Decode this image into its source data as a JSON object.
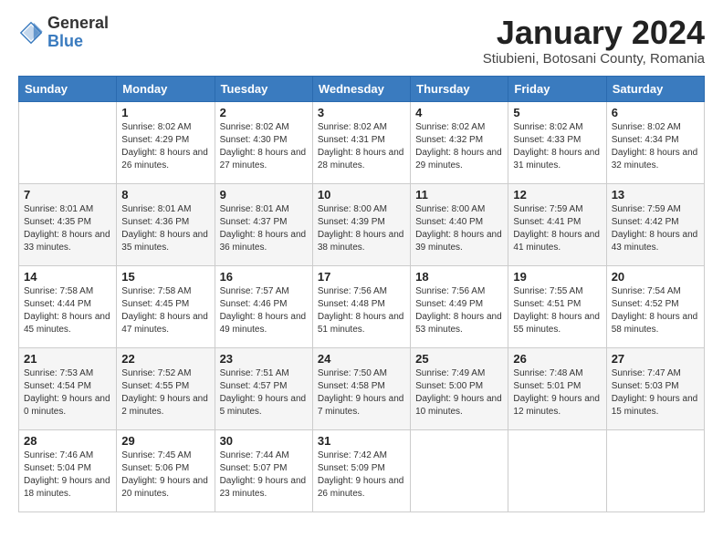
{
  "logo": {
    "general": "General",
    "blue": "Blue"
  },
  "title": "January 2024",
  "subtitle": "Stiubieni, Botosani County, Romania",
  "days_of_week": [
    "Sunday",
    "Monday",
    "Tuesday",
    "Wednesday",
    "Thursday",
    "Friday",
    "Saturday"
  ],
  "weeks": [
    [
      {
        "num": "",
        "sunrise": "",
        "sunset": "",
        "daylight": ""
      },
      {
        "num": "1",
        "sunrise": "Sunrise: 8:02 AM",
        "sunset": "Sunset: 4:29 PM",
        "daylight": "Daylight: 8 hours and 26 minutes."
      },
      {
        "num": "2",
        "sunrise": "Sunrise: 8:02 AM",
        "sunset": "Sunset: 4:30 PM",
        "daylight": "Daylight: 8 hours and 27 minutes."
      },
      {
        "num": "3",
        "sunrise": "Sunrise: 8:02 AM",
        "sunset": "Sunset: 4:31 PM",
        "daylight": "Daylight: 8 hours and 28 minutes."
      },
      {
        "num": "4",
        "sunrise": "Sunrise: 8:02 AM",
        "sunset": "Sunset: 4:32 PM",
        "daylight": "Daylight: 8 hours and 29 minutes."
      },
      {
        "num": "5",
        "sunrise": "Sunrise: 8:02 AM",
        "sunset": "Sunset: 4:33 PM",
        "daylight": "Daylight: 8 hours and 31 minutes."
      },
      {
        "num": "6",
        "sunrise": "Sunrise: 8:02 AM",
        "sunset": "Sunset: 4:34 PM",
        "daylight": "Daylight: 8 hours and 32 minutes."
      }
    ],
    [
      {
        "num": "7",
        "sunrise": "Sunrise: 8:01 AM",
        "sunset": "Sunset: 4:35 PM",
        "daylight": "Daylight: 8 hours and 33 minutes."
      },
      {
        "num": "8",
        "sunrise": "Sunrise: 8:01 AM",
        "sunset": "Sunset: 4:36 PM",
        "daylight": "Daylight: 8 hours and 35 minutes."
      },
      {
        "num": "9",
        "sunrise": "Sunrise: 8:01 AM",
        "sunset": "Sunset: 4:37 PM",
        "daylight": "Daylight: 8 hours and 36 minutes."
      },
      {
        "num": "10",
        "sunrise": "Sunrise: 8:00 AM",
        "sunset": "Sunset: 4:39 PM",
        "daylight": "Daylight: 8 hours and 38 minutes."
      },
      {
        "num": "11",
        "sunrise": "Sunrise: 8:00 AM",
        "sunset": "Sunset: 4:40 PM",
        "daylight": "Daylight: 8 hours and 39 minutes."
      },
      {
        "num": "12",
        "sunrise": "Sunrise: 7:59 AM",
        "sunset": "Sunset: 4:41 PM",
        "daylight": "Daylight: 8 hours and 41 minutes."
      },
      {
        "num": "13",
        "sunrise": "Sunrise: 7:59 AM",
        "sunset": "Sunset: 4:42 PM",
        "daylight": "Daylight: 8 hours and 43 minutes."
      }
    ],
    [
      {
        "num": "14",
        "sunrise": "Sunrise: 7:58 AM",
        "sunset": "Sunset: 4:44 PM",
        "daylight": "Daylight: 8 hours and 45 minutes."
      },
      {
        "num": "15",
        "sunrise": "Sunrise: 7:58 AM",
        "sunset": "Sunset: 4:45 PM",
        "daylight": "Daylight: 8 hours and 47 minutes."
      },
      {
        "num": "16",
        "sunrise": "Sunrise: 7:57 AM",
        "sunset": "Sunset: 4:46 PM",
        "daylight": "Daylight: 8 hours and 49 minutes."
      },
      {
        "num": "17",
        "sunrise": "Sunrise: 7:56 AM",
        "sunset": "Sunset: 4:48 PM",
        "daylight": "Daylight: 8 hours and 51 minutes."
      },
      {
        "num": "18",
        "sunrise": "Sunrise: 7:56 AM",
        "sunset": "Sunset: 4:49 PM",
        "daylight": "Daylight: 8 hours and 53 minutes."
      },
      {
        "num": "19",
        "sunrise": "Sunrise: 7:55 AM",
        "sunset": "Sunset: 4:51 PM",
        "daylight": "Daylight: 8 hours and 55 minutes."
      },
      {
        "num": "20",
        "sunrise": "Sunrise: 7:54 AM",
        "sunset": "Sunset: 4:52 PM",
        "daylight": "Daylight: 8 hours and 58 minutes."
      }
    ],
    [
      {
        "num": "21",
        "sunrise": "Sunrise: 7:53 AM",
        "sunset": "Sunset: 4:54 PM",
        "daylight": "Daylight: 9 hours and 0 minutes."
      },
      {
        "num": "22",
        "sunrise": "Sunrise: 7:52 AM",
        "sunset": "Sunset: 4:55 PM",
        "daylight": "Daylight: 9 hours and 2 minutes."
      },
      {
        "num": "23",
        "sunrise": "Sunrise: 7:51 AM",
        "sunset": "Sunset: 4:57 PM",
        "daylight": "Daylight: 9 hours and 5 minutes."
      },
      {
        "num": "24",
        "sunrise": "Sunrise: 7:50 AM",
        "sunset": "Sunset: 4:58 PM",
        "daylight": "Daylight: 9 hours and 7 minutes."
      },
      {
        "num": "25",
        "sunrise": "Sunrise: 7:49 AM",
        "sunset": "Sunset: 5:00 PM",
        "daylight": "Daylight: 9 hours and 10 minutes."
      },
      {
        "num": "26",
        "sunrise": "Sunrise: 7:48 AM",
        "sunset": "Sunset: 5:01 PM",
        "daylight": "Daylight: 9 hours and 12 minutes."
      },
      {
        "num": "27",
        "sunrise": "Sunrise: 7:47 AM",
        "sunset": "Sunset: 5:03 PM",
        "daylight": "Daylight: 9 hours and 15 minutes."
      }
    ],
    [
      {
        "num": "28",
        "sunrise": "Sunrise: 7:46 AM",
        "sunset": "Sunset: 5:04 PM",
        "daylight": "Daylight: 9 hours and 18 minutes."
      },
      {
        "num": "29",
        "sunrise": "Sunrise: 7:45 AM",
        "sunset": "Sunset: 5:06 PM",
        "daylight": "Daylight: 9 hours and 20 minutes."
      },
      {
        "num": "30",
        "sunrise": "Sunrise: 7:44 AM",
        "sunset": "Sunset: 5:07 PM",
        "daylight": "Daylight: 9 hours and 23 minutes."
      },
      {
        "num": "31",
        "sunrise": "Sunrise: 7:42 AM",
        "sunset": "Sunset: 5:09 PM",
        "daylight": "Daylight: 9 hours and 26 minutes."
      },
      {
        "num": "",
        "sunrise": "",
        "sunset": "",
        "daylight": ""
      },
      {
        "num": "",
        "sunrise": "",
        "sunset": "",
        "daylight": ""
      },
      {
        "num": "",
        "sunrise": "",
        "sunset": "",
        "daylight": ""
      }
    ]
  ]
}
